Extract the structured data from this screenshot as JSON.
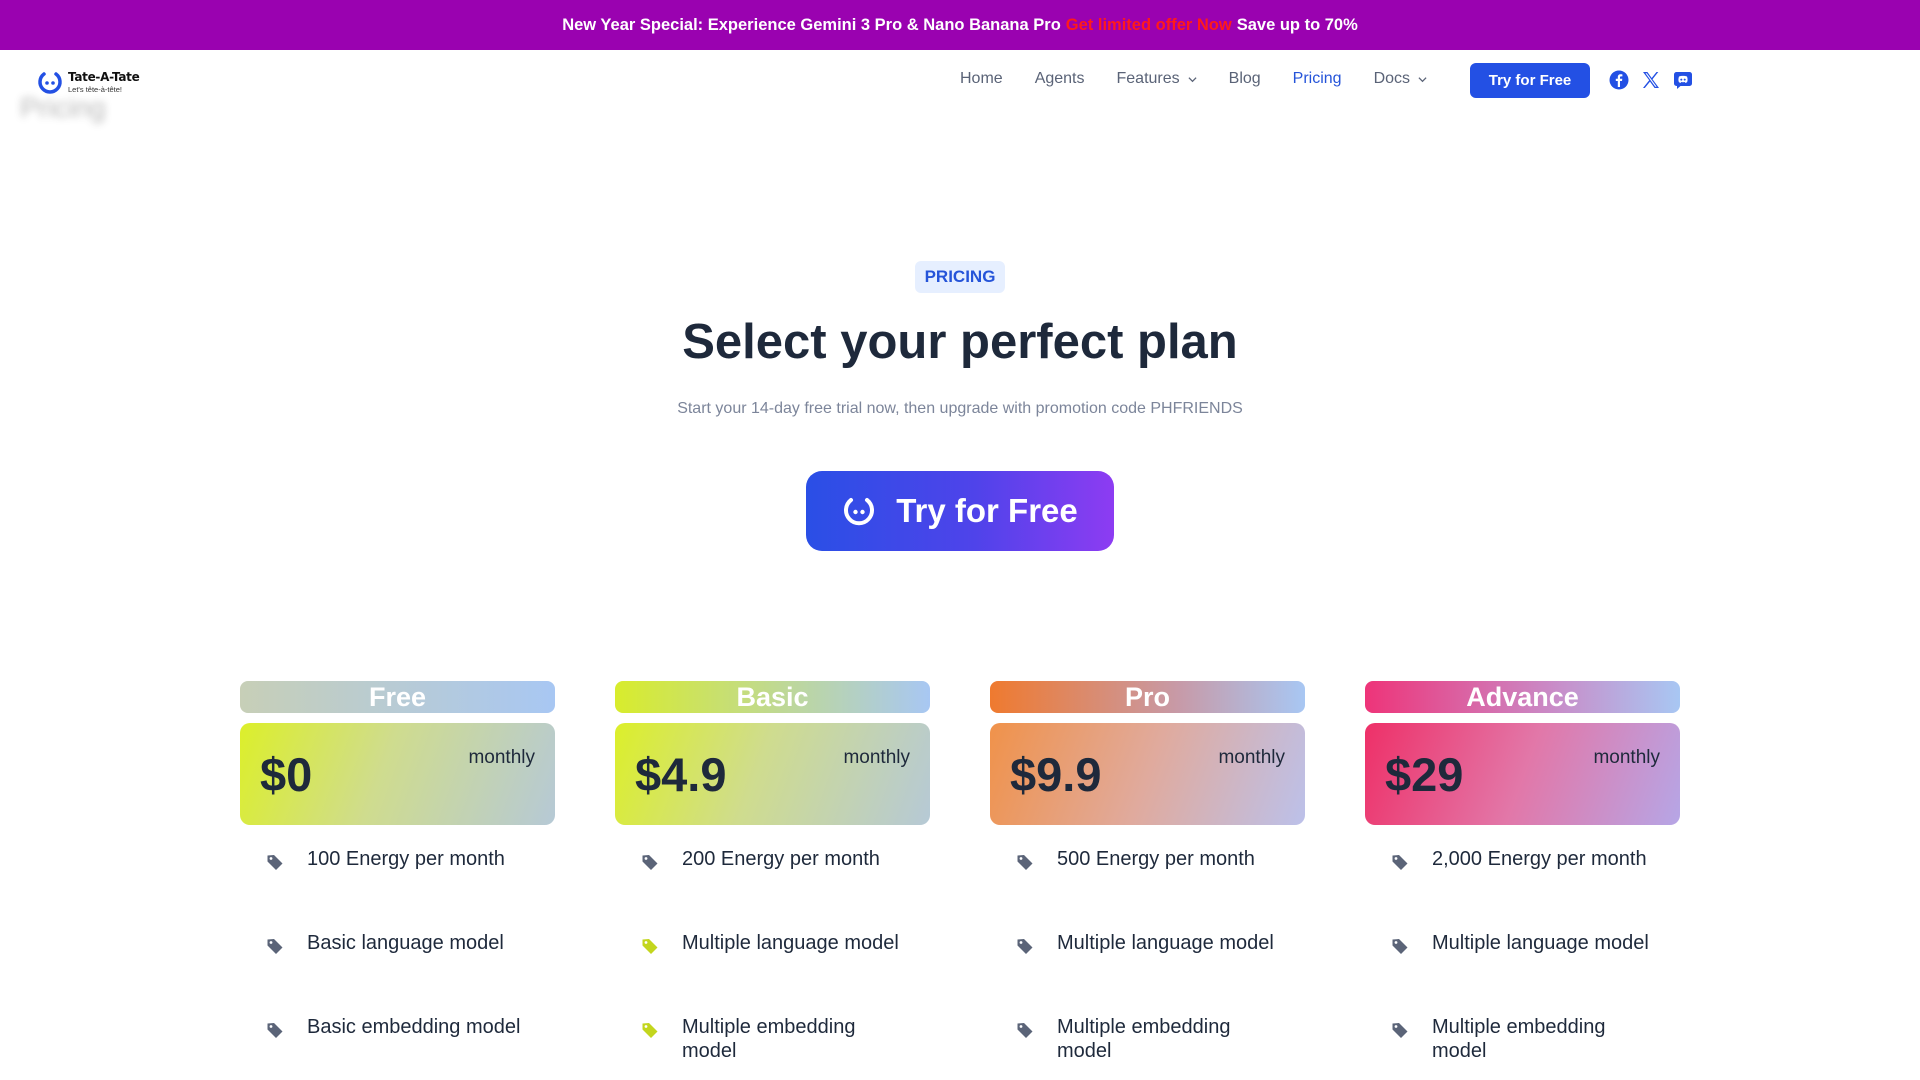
{
  "promo": {
    "text_before": "New Year Special: Experience Gemini 3 Pro & Nano Banana Pro",
    "hot_text": "Get limited offer Now",
    "text_after": "Save up to 70%"
  },
  "brand": {
    "name": "Tate-A-Tate",
    "tagline": "Let's tête-à-tête!",
    "ghost_title": "Pricing"
  },
  "nav": {
    "items": [
      {
        "label": "Home"
      },
      {
        "label": "Agents"
      },
      {
        "label": "Features",
        "dropdown": true
      },
      {
        "label": "Blog"
      },
      {
        "label": "Pricing",
        "active": true
      },
      {
        "label": "Docs",
        "dropdown": true
      }
    ],
    "cta": "Try for Free",
    "social": [
      "facebook-icon",
      "x-icon",
      "discord-icon"
    ]
  },
  "hero": {
    "badge": "PRICING",
    "title": "Select your perfect plan",
    "subtitle": "Start your 14-day free trial now, then upgrade with promotion code PHFRIENDS",
    "cta": "Try for Free"
  },
  "plans": [
    {
      "name": "Free",
      "price": "$0",
      "period": "monthly",
      "features": [
        "100 Energy per month",
        "Basic language model",
        "Basic embedding model"
      ],
      "tag_color": "#5b6478"
    },
    {
      "name": "Basic",
      "price": "$4.9",
      "period": "monthly",
      "features": [
        "200 Energy per month",
        "Multiple language model",
        "Multiple embedding model"
      ],
      "tag_color": "#c3d61e"
    },
    {
      "name": "Pro",
      "price": "$9.9",
      "period": "monthly",
      "features": [
        "500 Energy per month",
        "Multiple language model",
        "Multiple embedding model"
      ],
      "tag_color": "#5b6478"
    },
    {
      "name": "Advance",
      "price": "$29",
      "period": "monthly",
      "features": [
        "2,000 Energy per month",
        "Multiple language model",
        "Multiple embedding model"
      ],
      "tag_color": "#5b6478"
    }
  ],
  "colors": {
    "banner": "#9a02b0",
    "accent": "#2350e4",
    "hot": "#ff1a1a"
  }
}
